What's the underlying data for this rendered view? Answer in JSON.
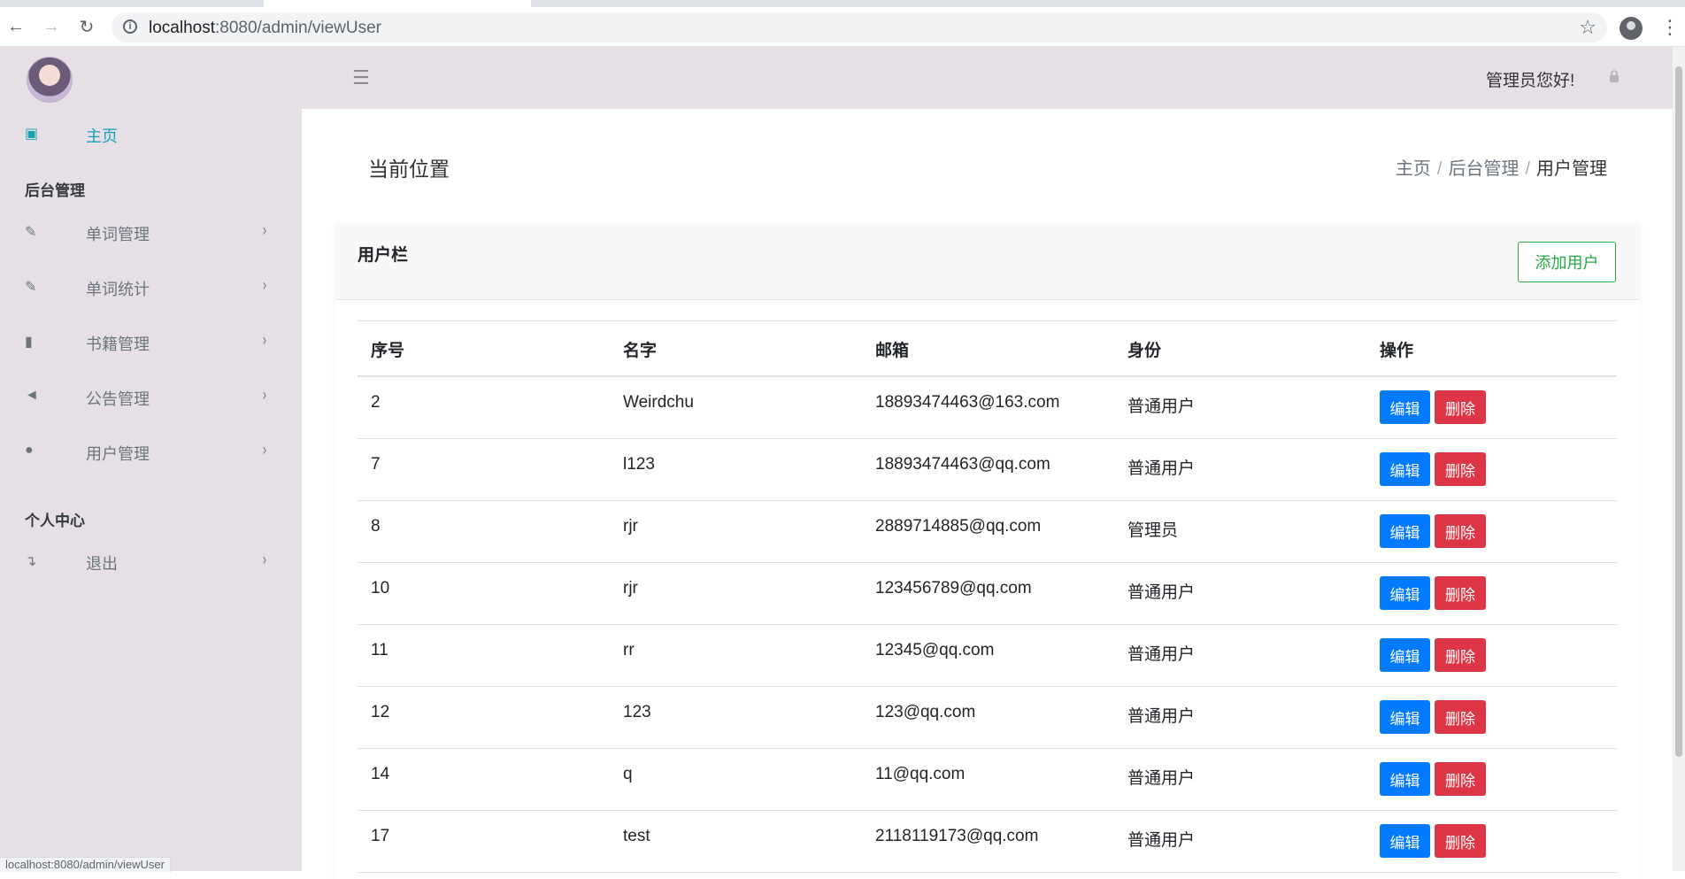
{
  "browser": {
    "url_host": "localhost",
    "url_rest": ":8080/admin/viewUser",
    "status_url": "localhost:8080/admin/viewUser"
  },
  "sidebar": {
    "home_label": "主页",
    "section_admin": "后台管理",
    "items": [
      {
        "label": "单词管理",
        "icon": "edit-icon"
      },
      {
        "label": "单词统计",
        "icon": "edit-icon"
      },
      {
        "label": "书籍管理",
        "icon": "book-icon"
      },
      {
        "label": "公告管理",
        "icon": "volume-icon"
      },
      {
        "label": "用户管理",
        "icon": "user-icon"
      }
    ],
    "section_personal": "个人中心",
    "logout_label": "退出"
  },
  "topbar": {
    "greeting": "管理员您好!"
  },
  "page": {
    "title": "当前位置",
    "breadcrumb": [
      "主页",
      "后台管理",
      "用户管理"
    ]
  },
  "card": {
    "title": "用户栏",
    "add_button": "添加用户"
  },
  "table": {
    "headers": [
      "序号",
      "名字",
      "邮箱",
      "身份",
      "操作"
    ],
    "edit_label": "编辑",
    "delete_label": "删除",
    "rows": [
      {
        "id": "2",
        "name": "Weirdchu",
        "email": "18893474463@163.com",
        "role": "普通用户"
      },
      {
        "id": "7",
        "name": "l123",
        "email": "18893474463@qq.com",
        "role": "普通用户"
      },
      {
        "id": "8",
        "name": "rjr",
        "email": "2889714885@qq.com",
        "role": "管理员"
      },
      {
        "id": "10",
        "name": "rjr",
        "email": "123456789@qq.com",
        "role": "普通用户"
      },
      {
        "id": "11",
        "name": "rr",
        "email": "12345@qq.com",
        "role": "普通用户"
      },
      {
        "id": "12",
        "name": "123",
        "email": "123@qq.com",
        "role": "普通用户"
      },
      {
        "id": "14",
        "name": "q",
        "email": "11@qq.com",
        "role": "普通用户"
      },
      {
        "id": "17",
        "name": "test",
        "email": "2118119173@qq.com",
        "role": "普通用户"
      }
    ]
  }
}
